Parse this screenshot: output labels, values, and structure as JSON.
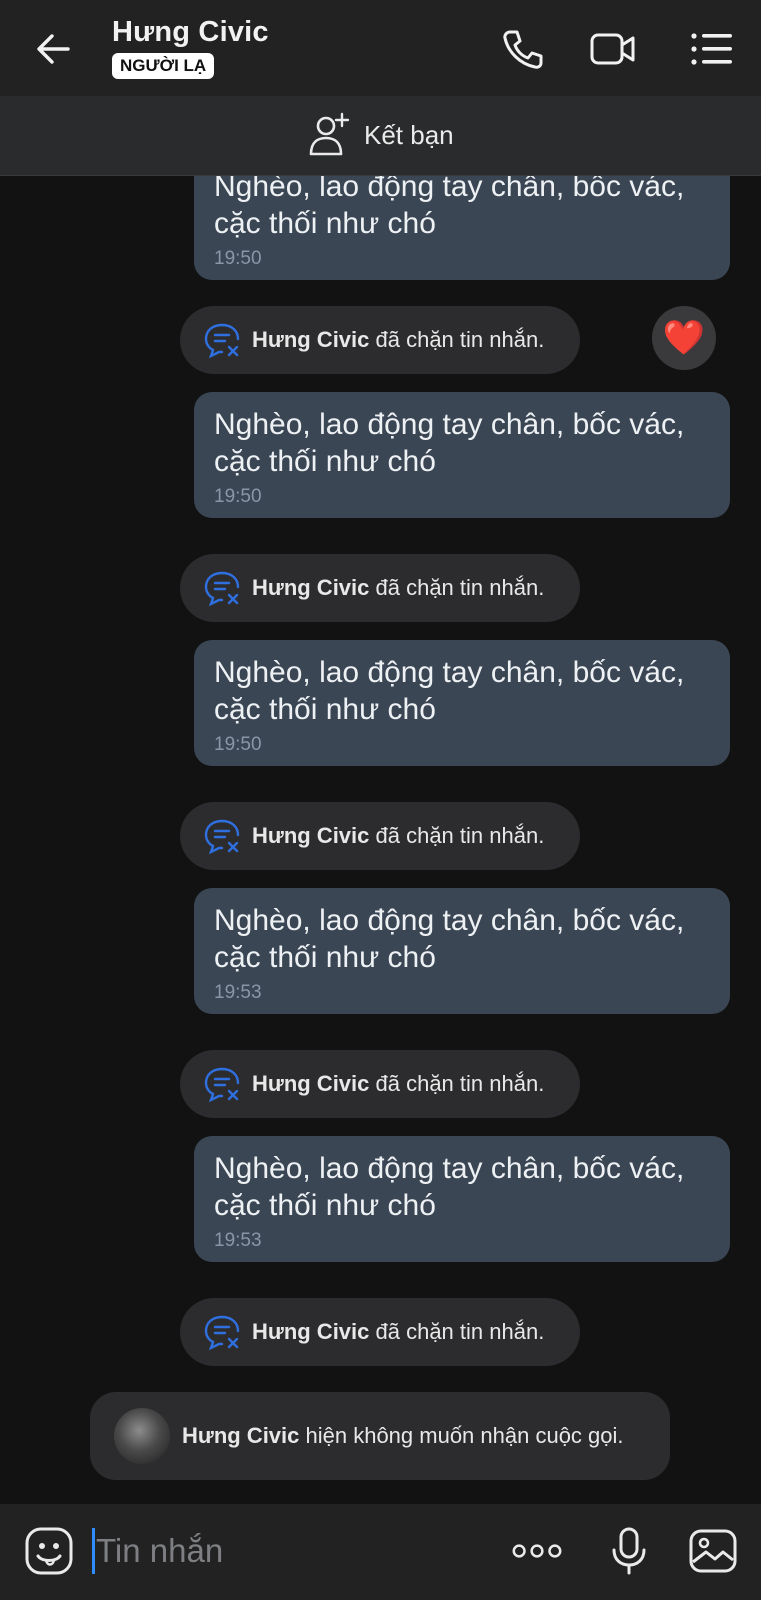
{
  "header": {
    "title": "Hưng Civic",
    "badge": "NGƯỜI LẠ",
    "icons": [
      "back-arrow-icon",
      "phone-icon",
      "video-camera-icon",
      "menu-list-icon"
    ]
  },
  "friend_bar": {
    "label": "Kết bạn",
    "icon": "add-user-icon"
  },
  "messages": [
    {
      "text_line1": "Nghèo, lao động tay chân, bốc vác,",
      "text_line2": "cặc thối như chó",
      "time": "19:50"
    },
    {
      "text_line1": "Nghèo, lao động tay chân, bốc vác,",
      "text_line2": "cặc thối như chó",
      "time": "19:50"
    },
    {
      "text_line1": "Nghèo, lao động tay chân, bốc vác,",
      "text_line2": "cặc thối như chó",
      "time": "19:50"
    },
    {
      "text_line1": "Nghèo, lao động tay chân, bốc vác,",
      "text_line2": "cặc thối như chó",
      "time": "19:53"
    },
    {
      "text_line1": "Nghèo, lao động tay chân, bốc vác,",
      "text_line2": "cặc thối như chó",
      "time": "19:53"
    }
  ],
  "block_notice": {
    "name": "Hưng Civic",
    "text": " đã chặn tin nhắn."
  },
  "reaction": "❤️",
  "call_notice": {
    "name": "Hưng Civic",
    "text": " hiện không muốn nhận cuộc gọi."
  },
  "input": {
    "placeholder": "Tin nhắn",
    "icons": [
      "emoji-icon",
      "more-options-icon",
      "microphone-icon",
      "image-icon"
    ]
  },
  "colors": {
    "accent": "#2f8cff",
    "bubble": "#3b4654",
    "background": "#121212",
    "block_icon": "#2f6fe0"
  }
}
